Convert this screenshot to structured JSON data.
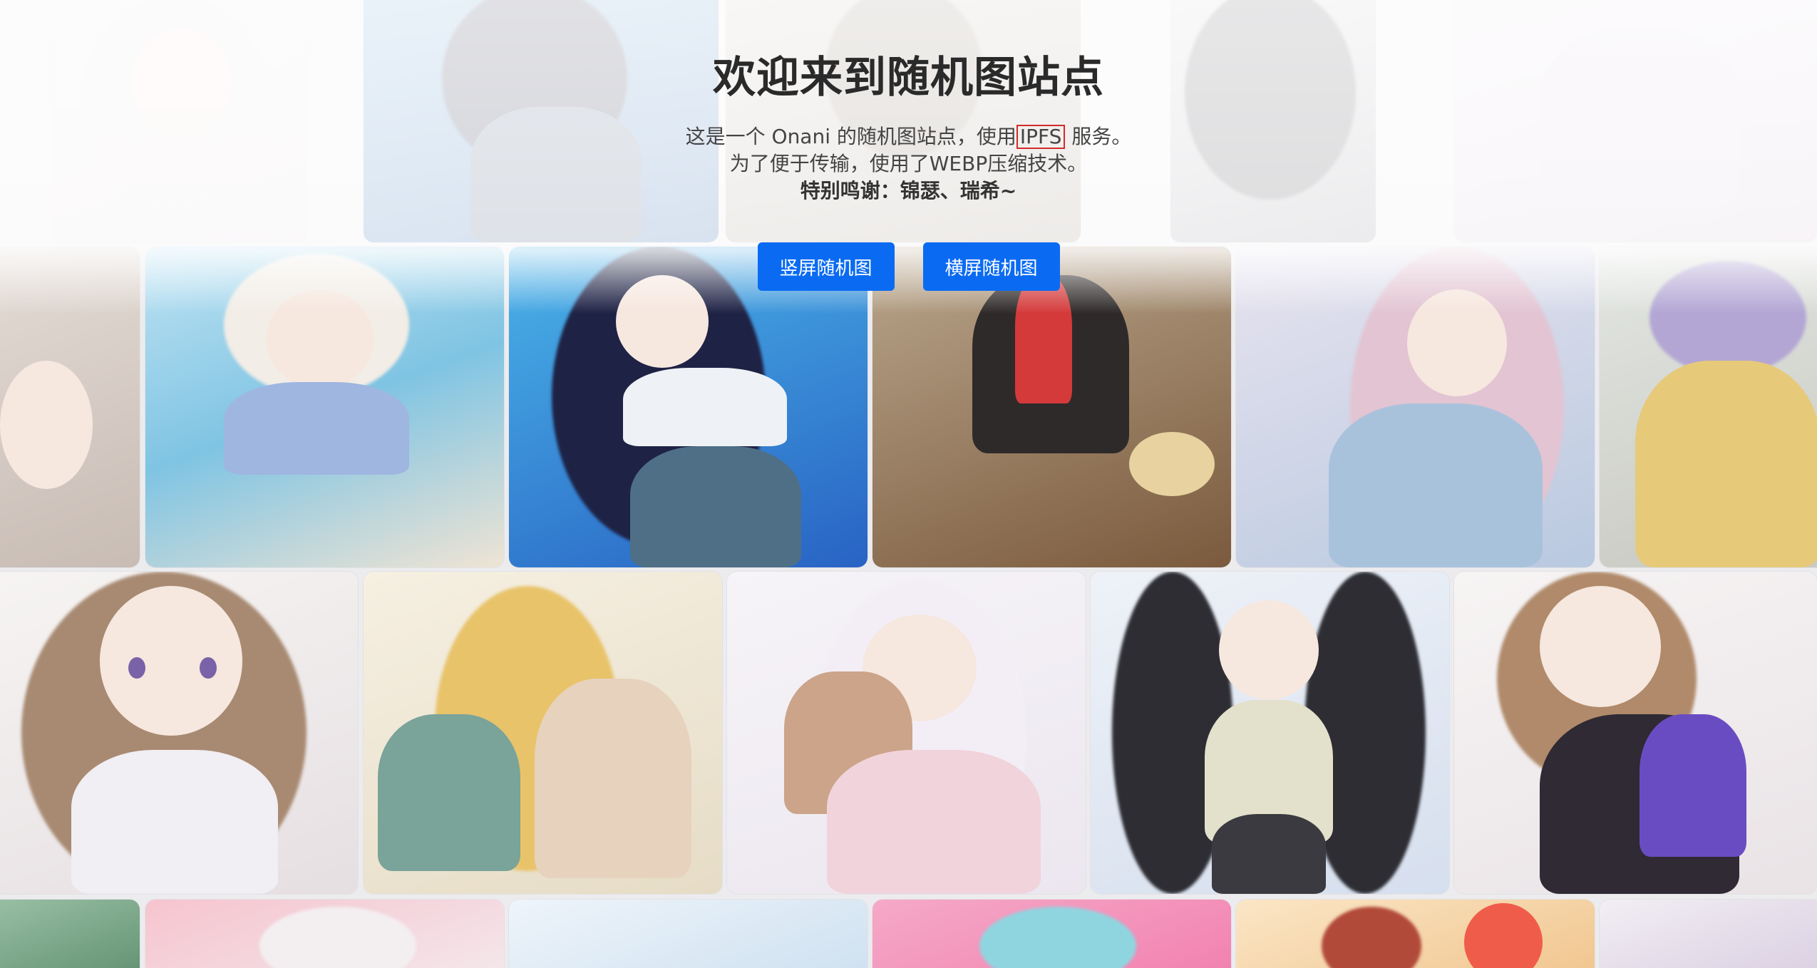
{
  "header": {
    "title": "欢迎来到随机图站点",
    "intro_prefix": "这是一个 Onani 的随机图站点，使用",
    "intro_link": "IPFS",
    "intro_suffix": "服务。",
    "line2": "为了便于传输，使用了WEBP压缩技术。",
    "thanks": "特别鸣谢：锦瑟、瑞希~"
  },
  "buttons": {
    "portrait": "竖屏随机图",
    "landscape": "横屏随机图"
  },
  "colors": {
    "accent": "#0a6bf2",
    "highlight_border": "#d42a2a",
    "title": "#2a2a2a"
  },
  "gallery": {
    "image_count": 22
  }
}
